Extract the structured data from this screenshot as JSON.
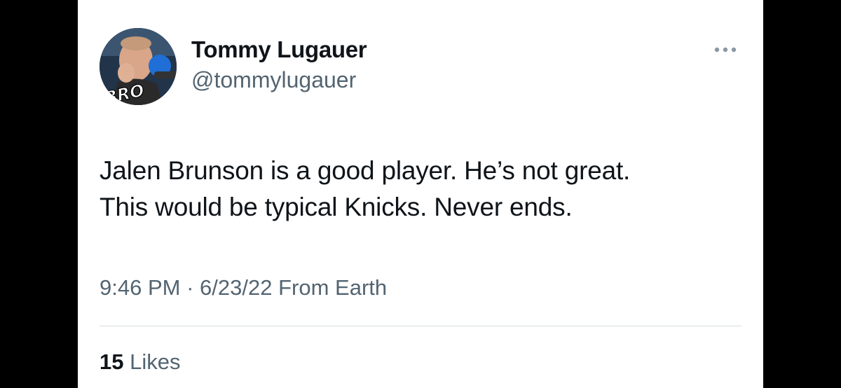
{
  "tweet": {
    "author": {
      "display_name": "Tommy Lugauer",
      "handle": "@tommylugauer",
      "avatar_badge_text": "BRO"
    },
    "more_icon": "more-horizontal-icon",
    "text_lines": [
      "Jalen Brunson is a good player. He’s not great.",
      "This would be typical Knicks. Never ends."
    ],
    "timestamp": {
      "time": "9:46 PM",
      "separator": "·",
      "date": "6/23/22",
      "source": "From Earth"
    },
    "likes": {
      "count": "15",
      "label": "Likes"
    }
  },
  "colors": {
    "primary_text": "#0f1419",
    "secondary_text": "#536471",
    "background": "#ffffff",
    "frame": "#000000",
    "divider": "#d6dce0"
  }
}
